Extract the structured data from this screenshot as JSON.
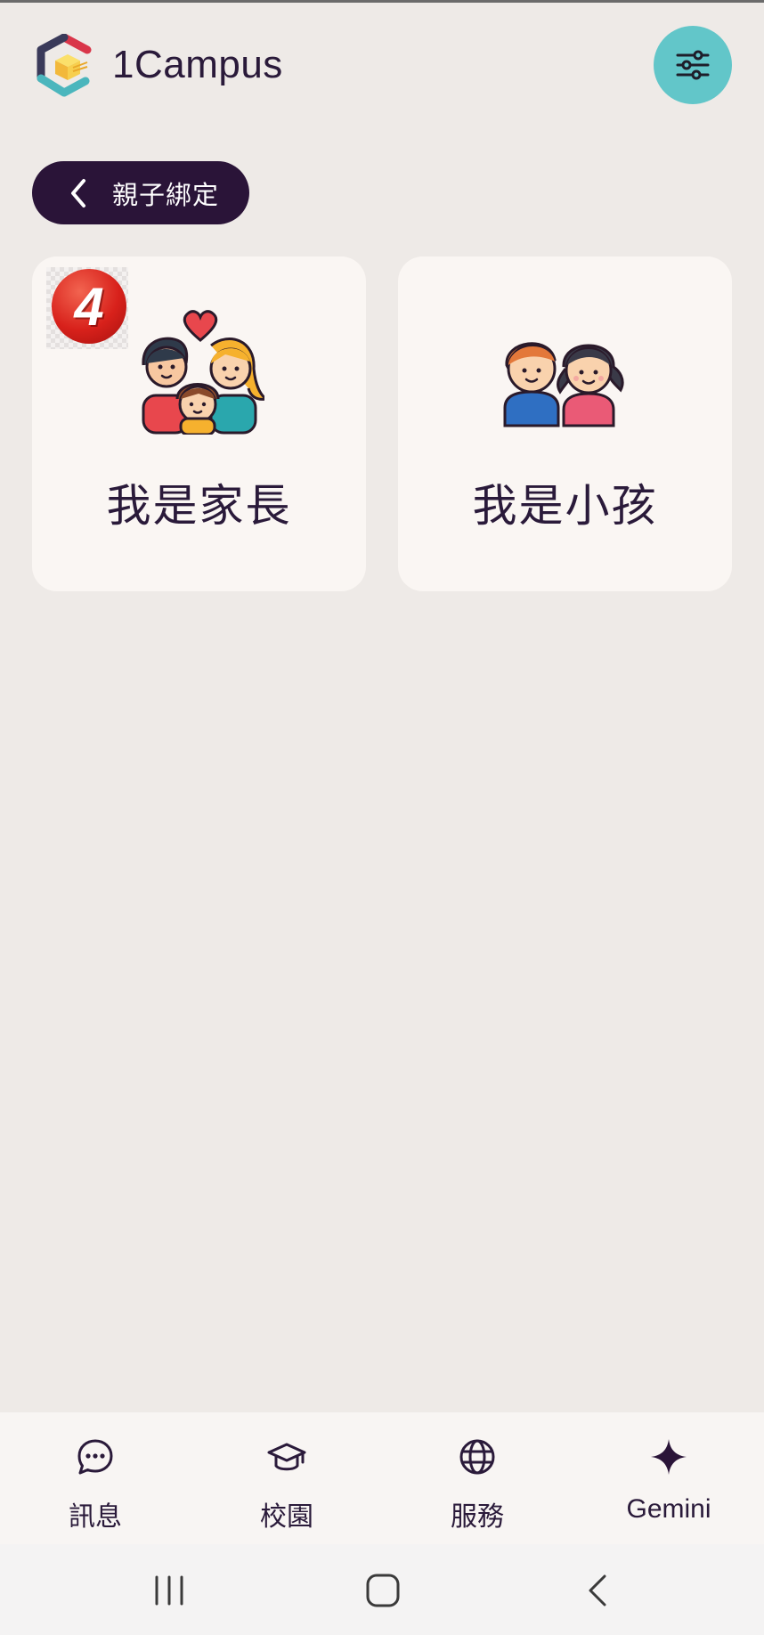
{
  "app": {
    "title": "1Campus",
    "logo_icon": "1campus-cube-logo-icon",
    "settings_icon": "sliders-icon"
  },
  "back_chip": {
    "label": "親子綁定",
    "icon": "chevron-left-icon"
  },
  "cards": [
    {
      "label": "我是家長",
      "icon": "family-icon",
      "badge": "4"
    },
    {
      "label": "我是小孩",
      "icon": "children-icon"
    }
  ],
  "bottom_nav": [
    {
      "label": "訊息",
      "icon": "chat-bubble-icon"
    },
    {
      "label": "校園",
      "icon": "graduation-cap-icon"
    },
    {
      "label": "服務",
      "icon": "globe-icon"
    },
    {
      "label": "Gemini",
      "icon": "sparkle-icon"
    }
  ],
  "system_nav": {
    "recent_icon": "recent-apps-icon",
    "home_icon": "home-icon",
    "back_icon": "back-icon"
  },
  "colors": {
    "background": "#eeeae7",
    "primary_dark": "#2a1438",
    "accent_teal": "#62c6c9",
    "card_bg": "#faf6f3",
    "badge_red": "#d8211b"
  }
}
